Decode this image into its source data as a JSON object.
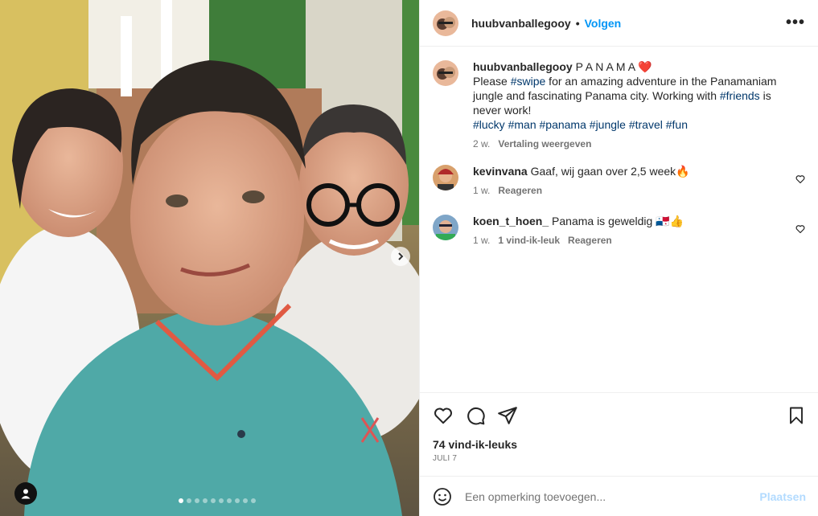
{
  "post": {
    "author": "huubvanballegooy",
    "separator": "•",
    "follow_label": "Volgen",
    "more_label": "•••"
  },
  "caption": {
    "username": "huubvanballegooy",
    "title": " P A N A M A ",
    "heart": "❤️",
    "line_intro": "Please ",
    "tag_swipe": "#swipe",
    "line_rest": " for an amazing adventure in the Panamaniam jungle and fascinating Panama city. Working with ",
    "tag_friends": "#friends",
    "line_end": " is never work!",
    "tags": [
      "#lucky",
      "#man",
      "#panama",
      "#jungle",
      "#travel",
      "#fun"
    ],
    "time": "2 w.",
    "translate_label": "Vertaling weergeven"
  },
  "comments": [
    {
      "username": "kevinvana",
      "text": "Gaaf, wij gaan over 2,5 week🔥",
      "time": "1 w.",
      "likes": "",
      "reply_label": "Reageren"
    },
    {
      "username": "koen_t_hoen_",
      "text": "Panama is geweldig 🇵🇦👍",
      "time": "1 w.",
      "likes": "1 vind-ik-leuk",
      "reply_label": "Reageren"
    }
  ],
  "stats": {
    "likes": "74 vind-ik-leuks",
    "date": "JULI 7"
  },
  "composer": {
    "placeholder": "Een opmerking toevoegen...",
    "post_label": "Plaatsen"
  },
  "carousel": {
    "count": 10,
    "active_index": 0
  },
  "colors": {
    "accent": "#0095f6",
    "hashtag": "#00376b",
    "muted": "#737373"
  }
}
